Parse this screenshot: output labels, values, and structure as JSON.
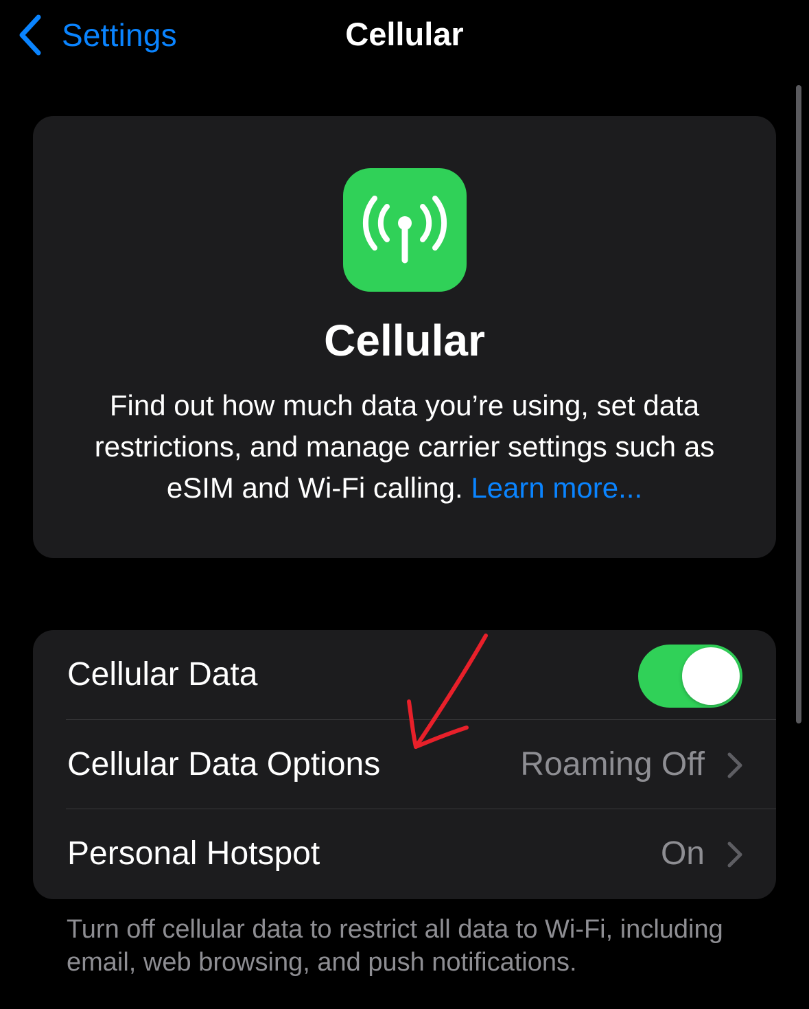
{
  "nav": {
    "back_label": "Settings",
    "title": "Cellular"
  },
  "hero": {
    "icon": "antenna-radiowaves-icon",
    "title": "Cellular",
    "description": "Find out how much data you’re using, set data restrictions, and manage carrier settings such as eSIM and Wi-Fi calling.",
    "learn_more": "Learn more..."
  },
  "settings": {
    "rows": [
      {
        "label": "Cellular Data",
        "control": "toggle",
        "toggle_on": true
      },
      {
        "label": "Cellular Data Options",
        "value": "Roaming Off",
        "control": "chevron"
      },
      {
        "label": "Personal Hotspot",
        "value": "On",
        "control": "chevron"
      }
    ]
  },
  "footer_note": "Turn off cellular data to restrict all data to Wi-Fi, including email, web browsing, and push notifications.",
  "colors": {
    "background": "#000000",
    "card": "#1c1c1e",
    "accent_blue": "#0a84ff",
    "green": "#30d158",
    "secondary_text": "#8e8e93",
    "annotation_red": "#e8202a"
  }
}
